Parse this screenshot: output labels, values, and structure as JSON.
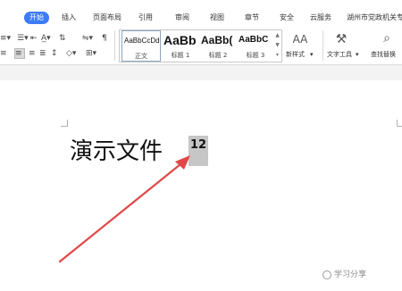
{
  "tabs": [
    {
      "label": "开始",
      "active": true
    },
    {
      "label": "插入"
    },
    {
      "label": "页面布局"
    },
    {
      "label": "引用"
    },
    {
      "label": "审阅"
    },
    {
      "label": "视图"
    },
    {
      "label": "章节"
    },
    {
      "label": "安全"
    },
    {
      "label": "云服务"
    },
    {
      "label": "湖州市党政机关专"
    }
  ],
  "styles": [
    {
      "sample": "AaBbCcDd",
      "name": "正文"
    },
    {
      "sample": "AaBb",
      "name": "标题 1"
    },
    {
      "sample": "AaBb(",
      "name": "标题 2"
    },
    {
      "sample": "AaBbC",
      "name": "标题 3"
    }
  ],
  "ribbon": {
    "new_style_label": "新样式",
    "text_tools_label": "文字工具",
    "find_replace_label": "查找替换",
    "new_style_icon_text": "AA"
  },
  "document": {
    "body_text": "演示文件",
    "selected_text": "12"
  },
  "watermark": "学习分享",
  "colors": {
    "accent": "#3d7bf7",
    "arrow": "#e04848",
    "selection": "#c6c6c6"
  },
  "icons": [
    "list-bullets-icon",
    "numbering-icon",
    "decrease-indent-icon",
    "increase-indent-icon",
    "text-direction-icon",
    "sort-icon",
    "show-marks-icon",
    "align-left-icon",
    "align-center-icon",
    "align-right-icon",
    "justify-icon",
    "distributed-icon",
    "line-spacing-icon",
    "shading-icon",
    "border-icon",
    "new-style-icon",
    "text-tools-icon",
    "find-replace-icon",
    "arrow-annotation"
  ]
}
